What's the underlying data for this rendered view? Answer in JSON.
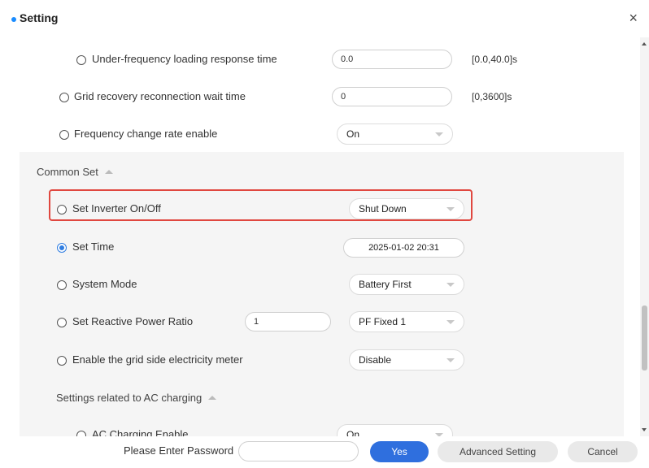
{
  "header": {
    "title": "Setting",
    "close_symbol": "×"
  },
  "rows_top": [
    {
      "label": "Under-frequency loading response time",
      "value": "0.0",
      "range": "[0.0,40.0]s"
    },
    {
      "label": "Grid recovery reconnection wait time",
      "value": "0",
      "range": "[0,3600]s"
    },
    {
      "label": "Frequency change rate enable",
      "selected": "On"
    }
  ],
  "common_set": {
    "title": "Common Set",
    "inverter_onoff": {
      "label": "Set Inverter On/Off",
      "selected": "Shut Down"
    },
    "set_time": {
      "label": "Set Time",
      "value": "2025-01-02 20:31",
      "checked": true
    },
    "system_mode": {
      "label": "System Mode",
      "selected": "Battery First"
    },
    "reactive_power": {
      "label": "Set Reactive Power Ratio",
      "value": "1",
      "selected": "PF Fixed 1"
    },
    "grid_meter": {
      "label": "Enable the grid side electricity meter",
      "selected": "Disable"
    },
    "ac_section_title": "Settings related to AC charging",
    "ac_charging": {
      "label": "AC Charging Enable",
      "selected": "On"
    }
  },
  "footer": {
    "password_label": "Please Enter Password",
    "password_value": "",
    "yes_label": "Yes",
    "advanced_label": "Advanced Setting",
    "cancel_label": "Cancel"
  },
  "colors": {
    "accent": "#2f6fde",
    "highlight": "#e0473f",
    "header_dot": "#1a8cff"
  }
}
